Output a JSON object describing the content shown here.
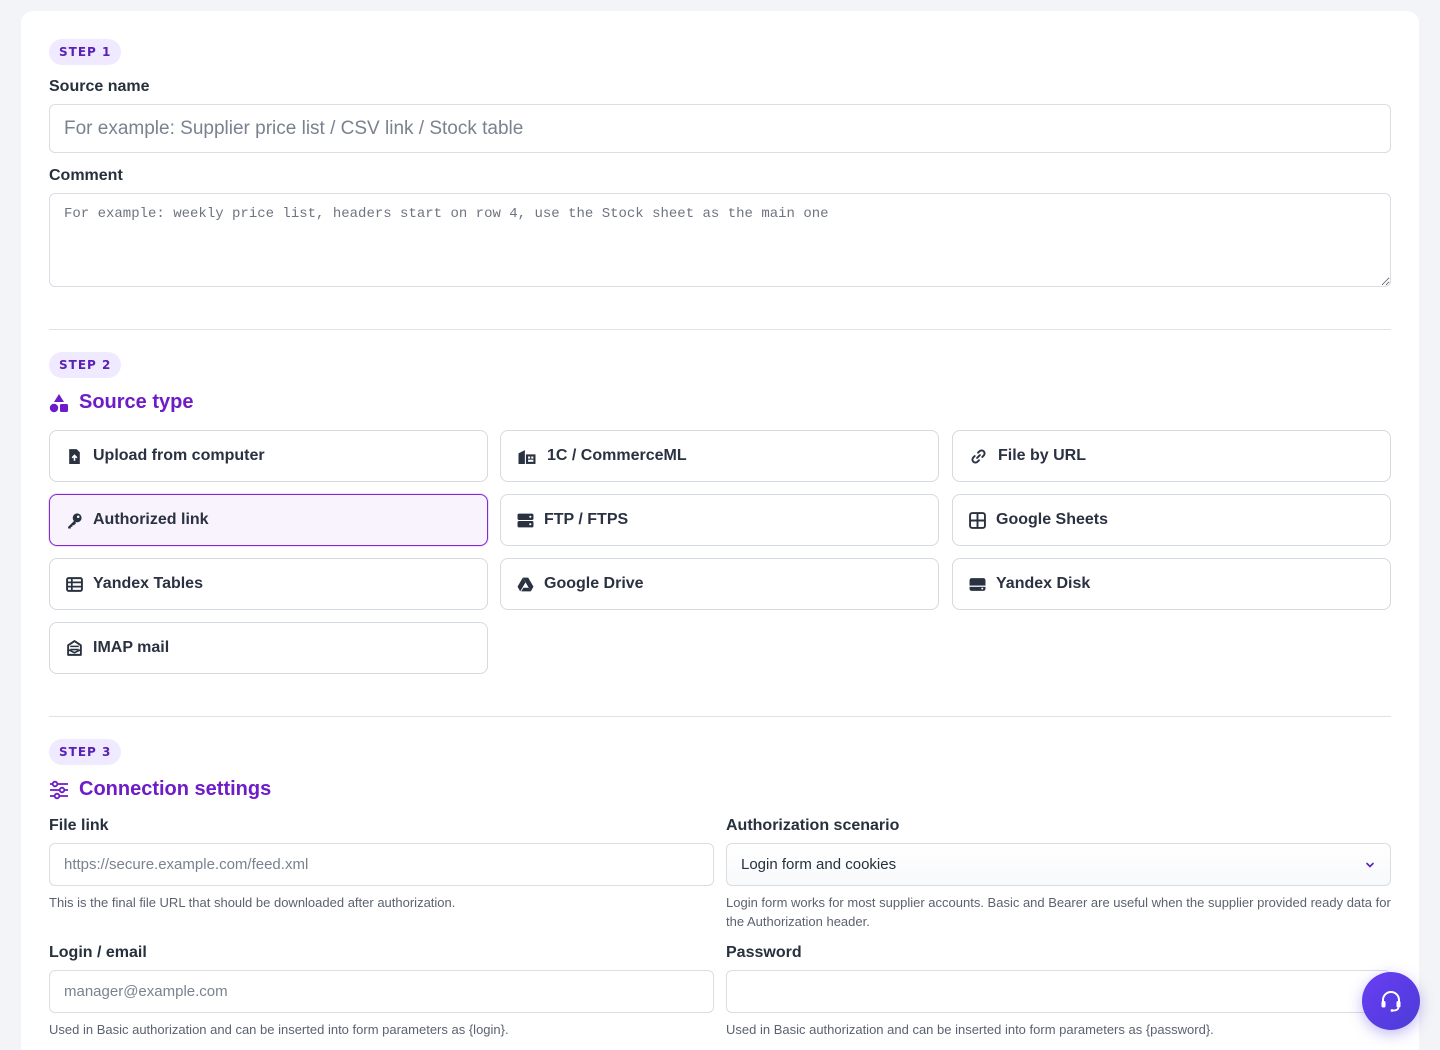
{
  "step1": {
    "badge": "STEP 1",
    "source_name_label": "Source name",
    "source_name_placeholder": "For example: Supplier price list / CSV link / Stock table",
    "comment_label": "Comment",
    "comment_placeholder": "For example: weekly price list, headers start on row 4, use the Stock sheet as the main one"
  },
  "step2": {
    "badge": "STEP 2",
    "title": "Source type",
    "options": [
      {
        "label": "Upload from computer",
        "icon": "file-upload-icon",
        "selected": false
      },
      {
        "label": "1C / CommerceML",
        "icon": "warehouse-icon",
        "selected": false
      },
      {
        "label": "File by URL",
        "icon": "link-icon",
        "selected": false
      },
      {
        "label": "Authorized link",
        "icon": "key-icon",
        "selected": true
      },
      {
        "label": "FTP / FTPS",
        "icon": "server-icon",
        "selected": false
      },
      {
        "label": "Google Sheets",
        "icon": "grid-icon",
        "selected": false
      },
      {
        "label": "Yandex Tables",
        "icon": "table-icon",
        "selected": false
      },
      {
        "label": "Google Drive",
        "icon": "google-drive-icon",
        "selected": false
      },
      {
        "label": "Yandex Disk",
        "icon": "hard-drive-icon",
        "selected": false
      },
      {
        "label": "IMAP mail",
        "icon": "mail-inbox-icon",
        "selected": false
      }
    ]
  },
  "step3": {
    "badge": "STEP 3",
    "title": "Connection settings",
    "file_link_label": "File link",
    "file_link_placeholder": "https://secure.example.com/feed.xml",
    "file_link_hint": "This is the final file URL that should be downloaded after authorization.",
    "auth_scenario_label": "Authorization scenario",
    "auth_scenario_value": "Login form and cookies",
    "auth_scenario_hint": "Login form works for most supplier accounts. Basic and Bearer are useful when the supplier provided ready data for the Authorization header.",
    "login_label": "Login / email",
    "login_placeholder": "manager@example.com",
    "login_hint": "Used in Basic authorization and can be inserted into form parameters as {login}.",
    "password_label": "Password",
    "password_placeholder": "",
    "password_hint": "Used in Basic authorization and can be inserted into form parameters as {password}."
  },
  "colors": {
    "accent": "#6d1cc8",
    "badge_bg": "#efeaff",
    "selected_border": "#7d2ccf",
    "fab": "#5b3ce6"
  },
  "support_button": {
    "icon": "headset-icon"
  }
}
